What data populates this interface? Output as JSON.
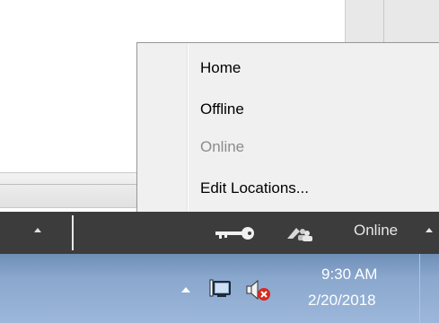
{
  "context_menu": {
    "items": [
      {
        "label": "Home",
        "enabled": true
      },
      {
        "label": "Offline",
        "enabled": true
      },
      {
        "label": "Online",
        "enabled": false
      },
      {
        "label": "Edit Locations...",
        "enabled": true
      }
    ]
  },
  "toolbar": {
    "icons": [
      "key-icon",
      "network-users-icon"
    ],
    "status_label": "Online",
    "colors": {
      "background": "#3c3c3c",
      "text": "#e6e6e6"
    }
  },
  "taskbar": {
    "clock_time": "9:30 AM",
    "clock_date": "2/20/2018",
    "icons": [
      "show-hidden-icons-arrow",
      "network-icon",
      "volume-muted-icon"
    ]
  }
}
